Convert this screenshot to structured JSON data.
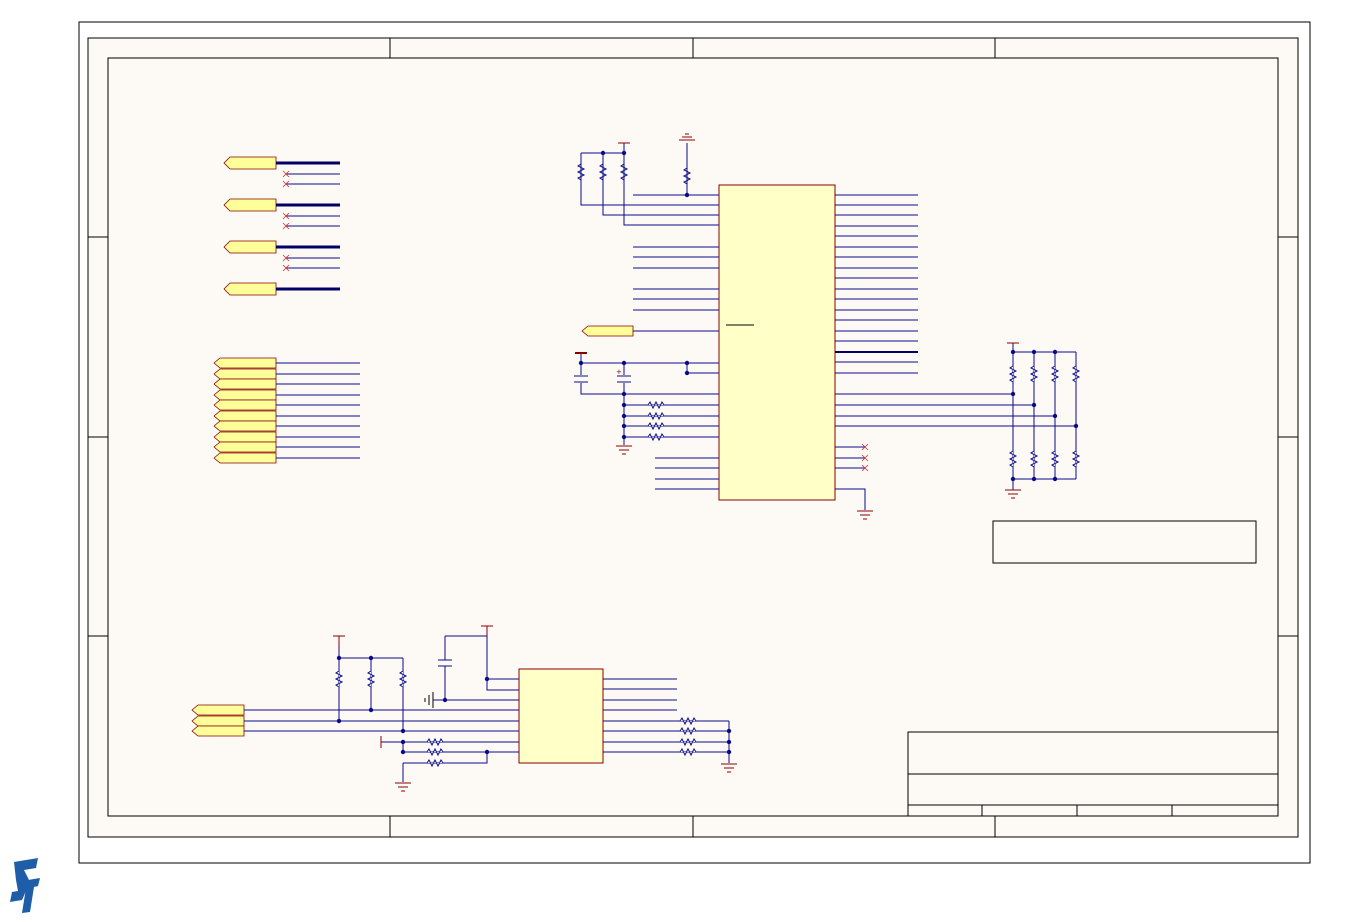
{
  "document": {
    "kind": "electronic schematic sheet",
    "visible_text": []
  },
  "colors": {
    "sheet_background": "#fdfaf5",
    "frame": "#000000",
    "wire": "#0a0a8c",
    "bus": "#000066",
    "power_symbol": "#8b0000",
    "ic_body_fill": "#ffffc8",
    "ic_body_outline": "#8b0000",
    "port_fill": "#ffff99",
    "port_outline": "#8b0000",
    "junction": "#0a0a8c",
    "no_connect": "#cc3333",
    "logo": "#1e5ea8"
  },
  "components": {
    "main_ic": {
      "type": "IC",
      "count": 1
    },
    "aux_ic": {
      "type": "IC",
      "count": 1
    },
    "resistors_top_pullups": 4,
    "resistors_series": 4,
    "resistors_right_network": 8,
    "resistors_bottom": 6,
    "capacitors": 3,
    "power_ports": 8,
    "ground_symbols": 6,
    "net_ports_left_bus": 4,
    "net_ports_left_stack": 10,
    "net_ports_bottom": 3,
    "no_connect_markers": 6
  },
  "frame": {
    "zone_columns": 4,
    "zone_rows": 4
  },
  "logo": {
    "icon": "st-logo-icon"
  }
}
